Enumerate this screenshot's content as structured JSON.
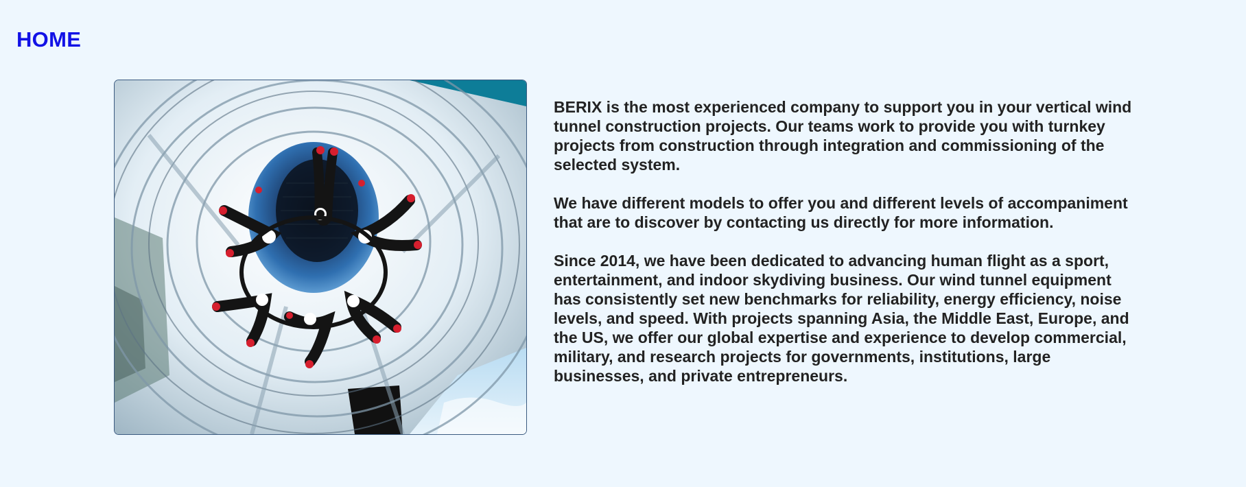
{
  "nav": {
    "home_label": "HOME"
  },
  "hero": {
    "image_icon": "indoor-skydiving-wind-tunnel-photo"
  },
  "content": {
    "paragraphs": [
      "BERIX is the most experienced company to support you in your vertical wind tunnel construction projects. Our teams work to provide you with turnkey projects from construction through integration and commissioning of the selected system.",
      "We have different models to offer you and different levels of accompaniment that are to discover by contacting us directly for more information.",
      "Since 2014, we have been dedicated to advancing human flight as a sport, entertainment, and indoor skydiving business. Our wind tunnel equipment has consistently set new benchmarks for reliability, energy efficiency, noise levels, and speed. With projects spanning Asia, the Middle East, Europe, and the US, we offer our global expertise and experience to develop commercial, military, and research projects for governments, institutions, large businesses, and private entrepreneurs."
    ]
  },
  "colors": {
    "background": "#eef7fe",
    "link": "#1212e6",
    "text": "#222222"
  }
}
